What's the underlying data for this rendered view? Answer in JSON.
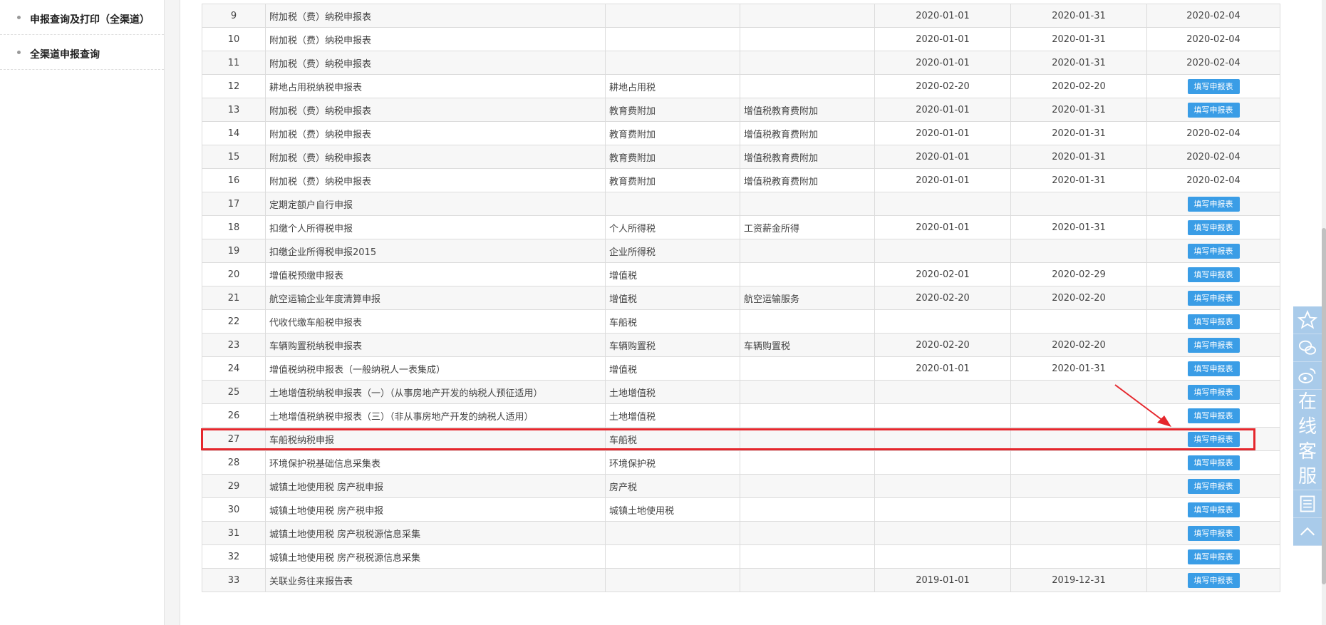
{
  "sidebar": {
    "items": [
      {
        "label": "申报查询及打印（全渠道）"
      },
      {
        "label": "全渠道申报查询"
      }
    ]
  },
  "table": {
    "button_label": "填写申报表",
    "rows": [
      {
        "no": "9",
        "name": "附加税（费）纳税申报表",
        "tax": "",
        "item": "",
        "start": "2020-01-01",
        "end": "2020-01-31",
        "deadline": "2020-02-04",
        "button": false
      },
      {
        "no": "10",
        "name": "附加税（费）纳税申报表",
        "tax": "",
        "item": "",
        "start": "2020-01-01",
        "end": "2020-01-31",
        "deadline": "2020-02-04",
        "button": false
      },
      {
        "no": "11",
        "name": "附加税（费）纳税申报表",
        "tax": "",
        "item": "",
        "start": "2020-01-01",
        "end": "2020-01-31",
        "deadline": "2020-02-04",
        "button": false
      },
      {
        "no": "12",
        "name": "耕地占用税纳税申报表",
        "tax": "耕地占用税",
        "item": "",
        "start": "2020-02-20",
        "end": "2020-02-20",
        "deadline": "",
        "button": true
      },
      {
        "no": "13",
        "name": "附加税（费）纳税申报表",
        "tax": "教育费附加",
        "item": "增值税教育费附加",
        "start": "2020-01-01",
        "end": "2020-01-31",
        "deadline": "",
        "button": true
      },
      {
        "no": "14",
        "name": "附加税（费）纳税申报表",
        "tax": "教育费附加",
        "item": "增值税教育费附加",
        "start": "2020-01-01",
        "end": "2020-01-31",
        "deadline": "2020-02-04",
        "button": false
      },
      {
        "no": "15",
        "name": "附加税（费）纳税申报表",
        "tax": "教育费附加",
        "item": "增值税教育费附加",
        "start": "2020-01-01",
        "end": "2020-01-31",
        "deadline": "2020-02-04",
        "button": false
      },
      {
        "no": "16",
        "name": "附加税（费）纳税申报表",
        "tax": "教育费附加",
        "item": "增值税教育费附加",
        "start": "2020-01-01",
        "end": "2020-01-31",
        "deadline": "2020-02-04",
        "button": false
      },
      {
        "no": "17",
        "name": "定期定额户自行申报",
        "tax": "",
        "item": "",
        "start": "",
        "end": "",
        "deadline": "",
        "button": true
      },
      {
        "no": "18",
        "name": "扣缴个人所得税申报",
        "tax": "个人所得税",
        "item": "工资薪金所得",
        "start": "2020-01-01",
        "end": "2020-01-31",
        "deadline": "",
        "button": true
      },
      {
        "no": "19",
        "name": "扣缴企业所得税申报2015",
        "tax": "企业所得税",
        "item": "",
        "start": "",
        "end": "",
        "deadline": "",
        "button": true
      },
      {
        "no": "20",
        "name": "增值税预缴申报表",
        "tax": "增值税",
        "item": "",
        "start": "2020-02-01",
        "end": "2020-02-29",
        "deadline": "",
        "button": true
      },
      {
        "no": "21",
        "name": "航空运输企业年度清算申报",
        "tax": "增值税",
        "item": "航空运输服务",
        "start": "2020-02-20",
        "end": "2020-02-20",
        "deadline": "",
        "button": true
      },
      {
        "no": "22",
        "name": "代收代缴车船税申报表",
        "tax": "车船税",
        "item": "",
        "start": "",
        "end": "",
        "deadline": "",
        "button": true
      },
      {
        "no": "23",
        "name": "车辆购置税纳税申报表",
        "tax": "车辆购置税",
        "item": "车辆购置税",
        "start": "2020-02-20",
        "end": "2020-02-20",
        "deadline": "",
        "button": true
      },
      {
        "no": "24",
        "name": "增值税纳税申报表（一般纳税人一表集成）",
        "tax": "增值税",
        "item": "",
        "start": "2020-01-01",
        "end": "2020-01-31",
        "deadline": "",
        "button": true
      },
      {
        "no": "25",
        "name": "土地增值税纳税申报表（一）（从事房地产开发的纳税人预征适用）",
        "tax": "土地增值税",
        "item": "",
        "start": "",
        "end": "",
        "deadline": "",
        "button": true
      },
      {
        "no": "26",
        "name": "土地增值税纳税申报表（三）（非从事房地产开发的纳税人适用）",
        "tax": "土地增值税",
        "item": "",
        "start": "",
        "end": "",
        "deadline": "",
        "button": true
      },
      {
        "no": "27",
        "name": "车船税纳税申报",
        "tax": "车船税",
        "item": "",
        "start": "",
        "end": "",
        "deadline": "",
        "button": true
      },
      {
        "no": "28",
        "name": "环境保护税基础信息采集表",
        "tax": "环境保护税",
        "item": "",
        "start": "",
        "end": "",
        "deadline": "",
        "button": true
      },
      {
        "no": "29",
        "name": "城镇土地使用税 房产税申报",
        "tax": "房产税",
        "item": "",
        "start": "",
        "end": "",
        "deadline": "",
        "button": true
      },
      {
        "no": "30",
        "name": "城镇土地使用税 房产税申报",
        "tax": "城镇土地使用税",
        "item": "",
        "start": "",
        "end": "",
        "deadline": "",
        "button": true
      },
      {
        "no": "31",
        "name": "城镇土地使用税 房产税税源信息采集",
        "tax": "",
        "item": "",
        "start": "",
        "end": "",
        "deadline": "",
        "button": true
      },
      {
        "no": "32",
        "name": "城镇土地使用税 房产税税源信息采集",
        "tax": "",
        "item": "",
        "start": "",
        "end": "",
        "deadline": "",
        "button": true
      },
      {
        "no": "33",
        "name": "关联业务往来报告表",
        "tax": "",
        "item": "",
        "start": "2019-01-01",
        "end": "2019-12-31",
        "deadline": "",
        "button": true
      }
    ]
  },
  "highlight": {
    "row_no": "27",
    "color": "#e5272d"
  },
  "float_toolbar": {
    "items": [
      {
        "icon": "star-icon"
      },
      {
        "icon": "wechat-icon"
      },
      {
        "icon": "weibo-icon"
      }
    ],
    "service_chars": [
      "在",
      "线",
      "客",
      "服"
    ],
    "bottom_items": [
      {
        "icon": "document-icon"
      },
      {
        "icon": "chevron-up-icon"
      }
    ]
  },
  "colors": {
    "button": "#3a9de6",
    "float_bar": "#a9cbea"
  }
}
